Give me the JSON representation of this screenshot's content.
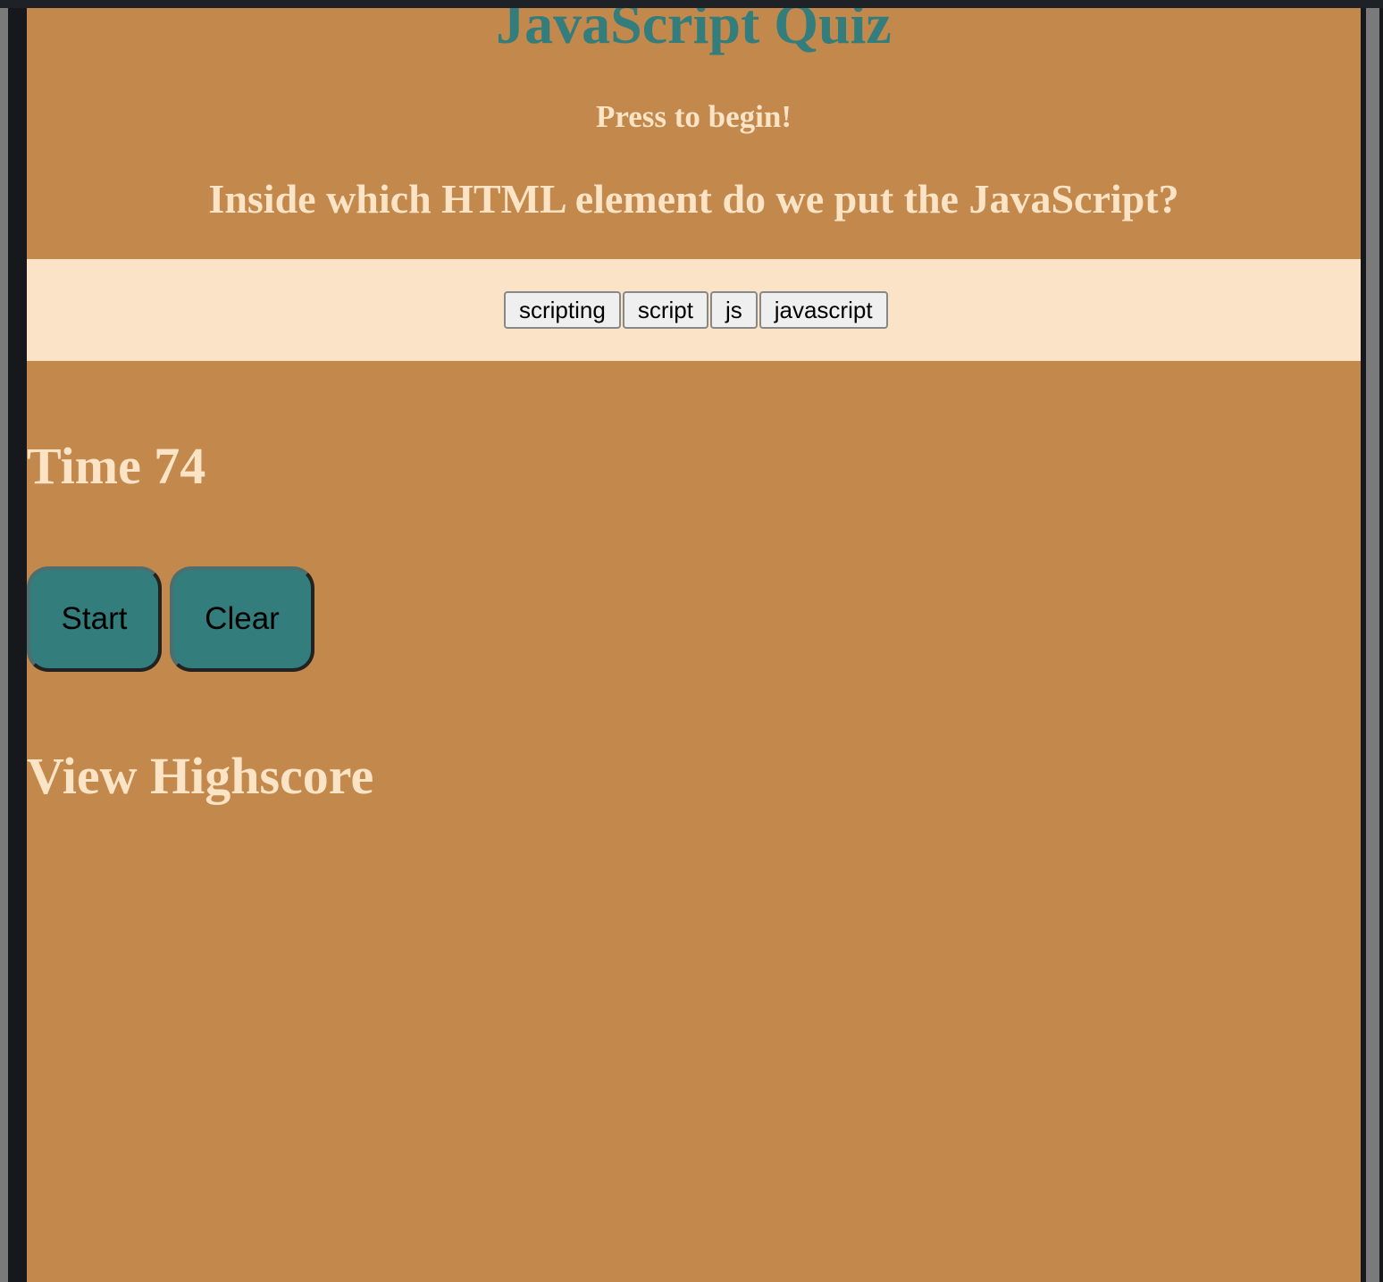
{
  "quiz": {
    "title": "JavaScript Quiz",
    "subtitle": "Press to begin!",
    "question": "Inside which HTML element do we put the JavaScript?",
    "answers": [
      "scripting",
      "script",
      "js",
      "javascript"
    ]
  },
  "timer": {
    "text": "Time 74"
  },
  "controls": {
    "start_label": "Start",
    "clear_label": "Clear"
  },
  "highscore": {
    "link_text": "View Highscore"
  },
  "colors": {
    "page_background": "#c2884c",
    "answer_band": "#fae3c7",
    "accent_teal": "#347d7d",
    "cream_text": "#fbe3c5"
  }
}
